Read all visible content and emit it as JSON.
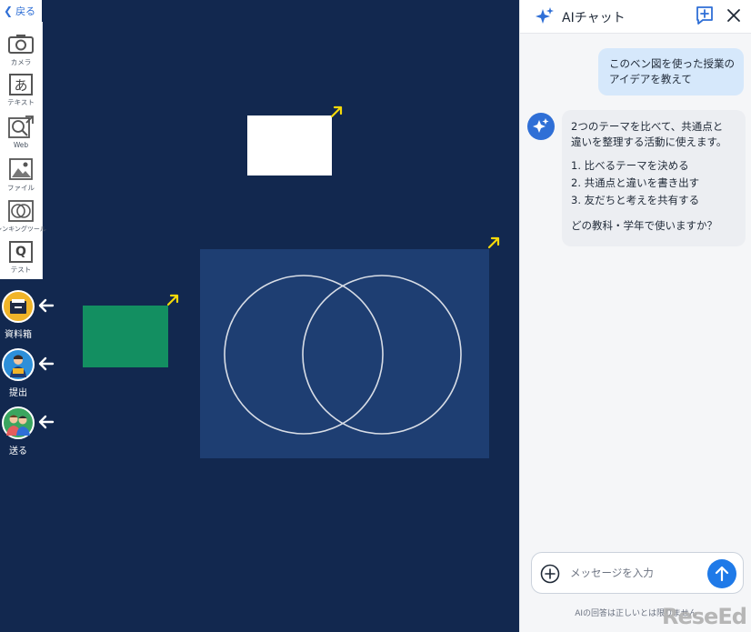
{
  "nav": {
    "back_label": "戻る"
  },
  "toolbar": {
    "tools": [
      {
        "label": "カメラ",
        "icon": "camera-icon"
      },
      {
        "label": "テキスト",
        "icon": "text-a-icon",
        "glyph": "あ"
      },
      {
        "label": "Web",
        "icon": "web-search-icon"
      },
      {
        "label": "ファイル",
        "icon": "image-file-icon"
      },
      {
        "label": "シンキングツール",
        "icon": "thinking-tool-icon"
      },
      {
        "label": "テスト",
        "icon": "test-q-icon",
        "glyph": "Q"
      }
    ]
  },
  "side_actions": [
    {
      "label": "資料箱",
      "icon": "materials-box-icon"
    },
    {
      "label": "提出",
      "icon": "submit-person-icon"
    },
    {
      "label": "送る",
      "icon": "send-people-icon"
    }
  ],
  "chat": {
    "title": "AIチャット",
    "user_message": [
      "このベン図を使った授業の",
      "アイデアを教えて"
    ],
    "ai_message": {
      "intro": [
        "2つのテーマを比べて、共通点と",
        "違いを整理する活動に使えます。"
      ],
      "steps": [
        "1. 比べるテーマを決める",
        "2. 共通点と違いを書き出す",
        "3. 友だちと考えを共有する"
      ],
      "question": "どの教科・学年で使いますか？"
    },
    "input_placeholder": "メッセージを入力",
    "disclaimer": "AIの回答は正しいとは限りません"
  },
  "watermark": "ReseEd",
  "colors": {
    "canvas_bg": "#12284f",
    "venn_panel": "#1e3e72",
    "green_card": "#138f61",
    "accent_blue": "#2f6fd6",
    "user_bubble": "#d6e8fb",
    "resize_arrow": "#f5d90a"
  }
}
